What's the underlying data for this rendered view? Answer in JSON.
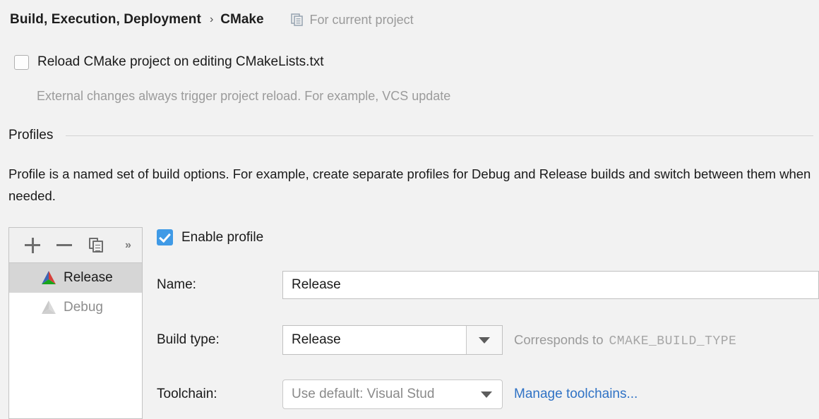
{
  "header": {
    "breadcrumb_root": "Build, Execution, Deployment",
    "breadcrumb_separator": "›",
    "breadcrumb_leaf": "CMake",
    "scope_icon": "project-scope-icon",
    "scope_label": "For current project"
  },
  "reload": {
    "checkbox_label": "Reload CMake project on editing CMakeLists.txt",
    "checked": false,
    "hint": "External changes always trigger project reload. For example, VCS update"
  },
  "profiles_section": {
    "title": "Profiles",
    "description": "Profile is a named set of build options. For example, create separate profiles for Debug and Release builds and switch between them when needed."
  },
  "list_toolbar": {
    "add": "+",
    "remove": "−",
    "copy": "copy-profile-icon",
    "more": "»"
  },
  "profile_list": [
    {
      "label": "Release",
      "selected": true,
      "enabled": true,
      "icon": "cmake-logo-icon"
    },
    {
      "label": "Debug",
      "selected": false,
      "enabled": false,
      "icon": "cmake-logo-icon"
    }
  ],
  "detail": {
    "enable_profile_label": "Enable profile",
    "enable_profile_checked": true,
    "name_label": "Name:",
    "name_value": "Release",
    "build_type_label": "Build type:",
    "build_type_value": "Release",
    "build_type_note": "Corresponds to",
    "build_type_note_mono": "CMAKE_BUILD_TYPE",
    "toolchain_label": "Toolchain:",
    "toolchain_value": "Use default: Visual Stud",
    "manage_toolchains_link": "Manage toolchains..."
  },
  "colors": {
    "background": "#f2f2f2",
    "accent_checkbox": "#3f9ae6",
    "link": "#2f72c5",
    "selected_row": "#d6d6d6",
    "muted_text": "#9a9a9a",
    "cmake_blue": "#3b65b5",
    "cmake_red": "#d5403a",
    "cmake_green": "#17a51b"
  }
}
